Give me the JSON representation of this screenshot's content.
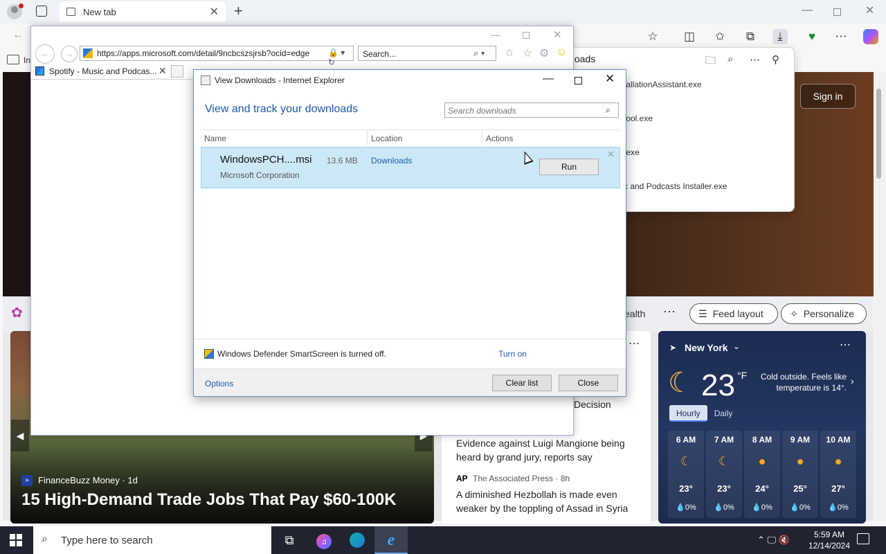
{
  "edge": {
    "tab_title": "New tab",
    "new_tab_glyph": "+",
    "downloads_title": "nloads",
    "downloads_items": [
      "tallationAssistant.exe",
      "tool.exe",
      ".exe",
      "c and Podcasts Installer.exe"
    ],
    "favbar_fragment": "In"
  },
  "msn": {
    "signin": "Sign in",
    "feed_category_fragment": "ealth",
    "feed_layout": "Feed layout",
    "personalize": "Personalize",
    "main_story": {
      "source": "FinanceBuzz Money · 1d",
      "headline": "15 High-Demand Trade Jobs That Pay $60-100K"
    },
    "news": {
      "fragment": "Decision",
      "item1": "Evidence against Luigi Mangione being heard by grand jury, reports say",
      "item2_logo": "AP",
      "item2_source": "The Associated Press · 8h",
      "item2": "A diminished Hezbollah is made even weaker by the toppling of Assad in Syria"
    },
    "weather": {
      "location": "New York",
      "temp": "23",
      "unit": "°F",
      "desc": "Cold outside. Feels like temperature is 14°.",
      "tabs": [
        "Hourly",
        "Daily"
      ],
      "hours": [
        {
          "time": "6 AM",
          "temp": "23°",
          "precip": "💧0%",
          "icon": "moon-icon"
        },
        {
          "time": "7 AM",
          "temp": "23°",
          "precip": "💧0%",
          "icon": "moon-icon"
        },
        {
          "time": "8 AM",
          "temp": "24°",
          "precip": "💧0%",
          "icon": "sun-icon"
        },
        {
          "time": "9 AM",
          "temp": "25°",
          "precip": "💧0%",
          "icon": "sun-icon"
        },
        {
          "time": "10 AM",
          "temp": "27°",
          "precip": "💧0%",
          "icon": "sun-icon"
        }
      ]
    }
  },
  "ie": {
    "address": "https://apps.microsoft.com/detail/9ncbcszsjrsb?ocid=edge",
    "search_placeholder": "Search...",
    "tab_title": "Spotify - Music and Podcas..."
  },
  "downloads_dialog": {
    "title": "View Downloads - Internet Explorer",
    "heading": "View and track your downloads",
    "search_placeholder": "Search downloads",
    "columns": [
      "Name",
      "Location",
      "Actions"
    ],
    "item": {
      "filename": "WindowsPCH....msi",
      "size": "13.6 MB",
      "location": "Downloads",
      "publisher": "Microsoft Corporation",
      "action": "Run"
    },
    "smartscreen": "Windows Defender SmartScreen is turned off.",
    "turn_on": "Turn on",
    "options": "Options",
    "clear_list": "Clear list",
    "close": "Close"
  },
  "taskbar": {
    "search_placeholder": "Type here to search",
    "time": "5:59 AM",
    "date": "12/14/2024"
  }
}
